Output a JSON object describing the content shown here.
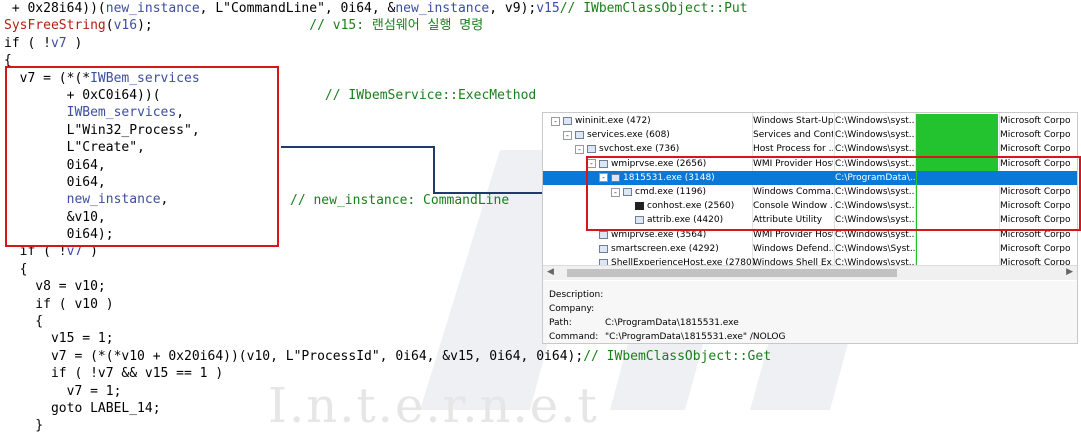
{
  "watermark": {
    "text": "I.n.t.e.r.n.e.t"
  },
  "code": {
    "lines": [
      {
        "t": "v7 = (*(*",
        "v": "new_instance",
        "r": " + 0x28i64))(",
        "v2": "new_instance",
        "r2": ", L\"CommandLine\", 0i64, &",
        "v3": "v15",
        "r3": ", v9);",
        "c": "// IWbemClassObject::Put"
      },
      {
        "f": "SysFreeString",
        "r": "(",
        "v": "v16",
        "r2": ");",
        "pad": "                    ",
        "c": "// v15: 랜섬웨어 실행 명령"
      },
      {
        "r": "if ( !",
        "v": "v7",
        "r2": " )"
      },
      {
        "r": "{"
      },
      {
        "r": "  v7 = (*(*",
        "v": "IWBem_services",
        "r2": ""
      },
      {
        "r": "        + 0xC0i64))(",
        "pad": "                     ",
        "c": "// IWbemService::ExecMethod"
      },
      {
        "r": "        ",
        "v": "IWBem_services",
        "r2": ","
      },
      {
        "r": "        L\"Win32_Process\","
      },
      {
        "r": "        L\"Create\","
      },
      {
        "r": "        0i64,"
      },
      {
        "r": "        0i64,"
      },
      {
        "r": "        ",
        "v": "new_instance",
        "r2": ","
      },
      {
        "r": "        &v10,"
      },
      {
        "r": "        0i64);"
      },
      {
        "r": "  if ( !",
        "v": "v7",
        "r2": " )"
      },
      {
        "r": "  {"
      },
      {
        "r": "    v8 = v10;"
      },
      {
        "r": "    if ( v10 )"
      },
      {
        "r": "    {"
      },
      {
        "r": "      v15 = 1;"
      },
      {
        "r": "      v7 = (*(*v10 + 0x20i64))(v10, L\"ProcessId\", 0i64, &v15, 0i64, 0i64);",
        "c": "// IWbemClassObject::Get"
      },
      {
        "r": "      if ( !v7 && v15 == 1 )"
      },
      {
        "r": "        v7 = 1;"
      },
      {
        "r": "      goto LABEL_14;"
      },
      {
        "r": "    }"
      }
    ],
    "side_comment": "// new_instance: CommandLine"
  },
  "procexp": {
    "rows": [
      {
        "name": "wininit.exe (472)",
        "indent": 0,
        "exp": "-",
        "desc": "Windows Start-Up...",
        "path": "C:\\Windows\\syst...",
        "cpu": true,
        "comp": "Microsoft Corpo"
      },
      {
        "name": "services.exe (608)",
        "indent": 1,
        "exp": "-",
        "desc": "Services and Cont...",
        "path": "C:\\Windows\\syst...",
        "cpu": true,
        "comp": "Microsoft Corpo"
      },
      {
        "name": "svchost.exe (736)",
        "indent": 2,
        "exp": "-",
        "desc": "Host Process for ...",
        "path": "C:\\Windows\\syst...",
        "cpu": true,
        "comp": "Microsoft Corpo"
      },
      {
        "name": "wmiprvse.exe (2656)",
        "indent": 3,
        "exp": "-",
        "desc": "WMI Provider Host",
        "path": "C:\\Windows\\syst...",
        "cpu": true,
        "comp": "Microsoft Corpo"
      },
      {
        "name": "1815531.exe (3148)",
        "indent": 4,
        "exp": "-",
        "desc": "",
        "path": "C:\\ProgramData\\...",
        "cpu": false,
        "comp": "",
        "selected": true
      },
      {
        "name": "cmd.exe (1196)",
        "indent": 5,
        "exp": "-",
        "desc": "Windows Comma...",
        "path": "C:\\Windows\\syst...",
        "cpu": false,
        "comp": "Microsoft Corpo"
      },
      {
        "name": "conhost.exe (2560)",
        "indent": 6,
        "exp": "",
        "desc": "Console Window ...",
        "path": "C:\\Windows\\syst...",
        "cpu": false,
        "comp": "Microsoft Corpo",
        "console": true
      },
      {
        "name": "attrib.exe (4420)",
        "indent": 6,
        "exp": "",
        "desc": "Attribute Utility",
        "path": "C:\\Windows\\syst...",
        "cpu": false,
        "comp": "Microsoft Corpo"
      },
      {
        "name": "wmiprvse.exe (3564)",
        "indent": 3,
        "exp": "",
        "desc": "WMI Provider Host",
        "path": "C:\\Windows\\syst...",
        "cpu": false,
        "comp": "Microsoft Corpo"
      },
      {
        "name": "smartscreen.exe (4292)",
        "indent": 3,
        "exp": "",
        "desc": "Windows Defend...",
        "path": "C:\\Windows\\Syst...",
        "cpu": false,
        "comp": "Microsoft Corpo"
      },
      {
        "name": "ShellExperienceHost.exe (2780)",
        "indent": 3,
        "exp": "",
        "desc": "Windows Shell Ex...",
        "path": "C:\\Windows\\syst...",
        "cpu": false,
        "comp": "Microsoft Corpo"
      }
    ],
    "details": {
      "description_label": "Description:",
      "description_value": "",
      "company_label": "Company:",
      "company_value": "",
      "path_label": "Path:",
      "path_value": "C:\\ProgramData\\1815531.exe",
      "command_label": "Command:",
      "command_value": "\"C:\\ProgramData\\1815531.exe\" /NOLOG"
    },
    "colors": {
      "selection": "#0a78d7",
      "cpu_bar": "#22c32e"
    }
  },
  "colors": {
    "highlight": "#d8141c",
    "arrow": "#1f3a6b",
    "comment": "#1a7f1a"
  }
}
